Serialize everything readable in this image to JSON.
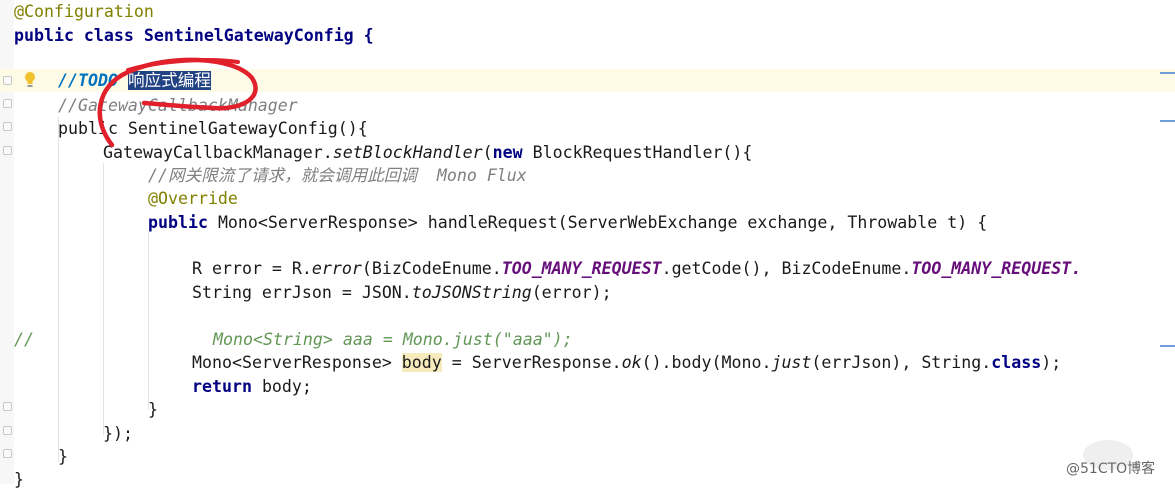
{
  "editor": {
    "lines": [
      {
        "text": "@Configuration"
      },
      {
        "text": "public class SentinelGatewayConfig {"
      },
      {
        "text": ""
      },
      {
        "todo_prefix": "//",
        "todo_tag": "TODO",
        "todo_selected": "响应式编程"
      },
      {
        "text": "//GatewayCallbackManager"
      },
      {
        "text": "public SentinelGatewayConfig(){"
      },
      {
        "a": "GatewayCallbackManager.",
        "b": "setBlockHandler",
        "c": "(",
        "d": "new",
        "e": " BlockRequestHandler(){"
      },
      {
        "text": "//网关限流了请求，就会调用此回调  Mono Flux"
      },
      {
        "text": "@Override"
      },
      {
        "kw": "public",
        "text": " Mono<ServerResponse> handleRequest(ServerWebExchange exchange, Throwable t) {"
      },
      {
        "text": ""
      },
      {
        "a": "R error = R.",
        "b": "error",
        "c": "(BizCodeEnume.",
        "d": "TOO_MANY_REQUEST",
        "e": ".getCode(), BizCodeEnume.",
        "f": "TOO_MANY_REQUEST."
      },
      {
        "a": "String errJson = JSON.",
        "b": "toJSONString",
        "c": "(error);"
      },
      {
        "text": ""
      },
      {
        "prefix": "//",
        "text": "Mono<String> aaa = Mono.just(\"aaa\");"
      },
      {
        "a": "Mono<ServerResponse> ",
        "b": "body",
        "c": " = ServerResponse.",
        "d": "ok",
        "e": "().body(Mono.",
        "f": "just",
        "g": "(errJson), String.",
        "h": "class",
        "i": ");"
      },
      {
        "kw": "return",
        "text": " body;"
      },
      {
        "text": "}"
      },
      {
        "text": "});"
      },
      {
        "text": "}"
      },
      {
        "text": "}"
      }
    ]
  },
  "colors": {
    "keyword": "#000080",
    "annotation": "#808000",
    "comment": "#808080",
    "todo": "#0073bf",
    "constant": "#660e7a",
    "selection": "#214283",
    "scribble": "#e0202a"
  },
  "icons": {
    "lightbulb": "intention-lightbulb-icon"
  },
  "watermark": "@51CTO博客"
}
